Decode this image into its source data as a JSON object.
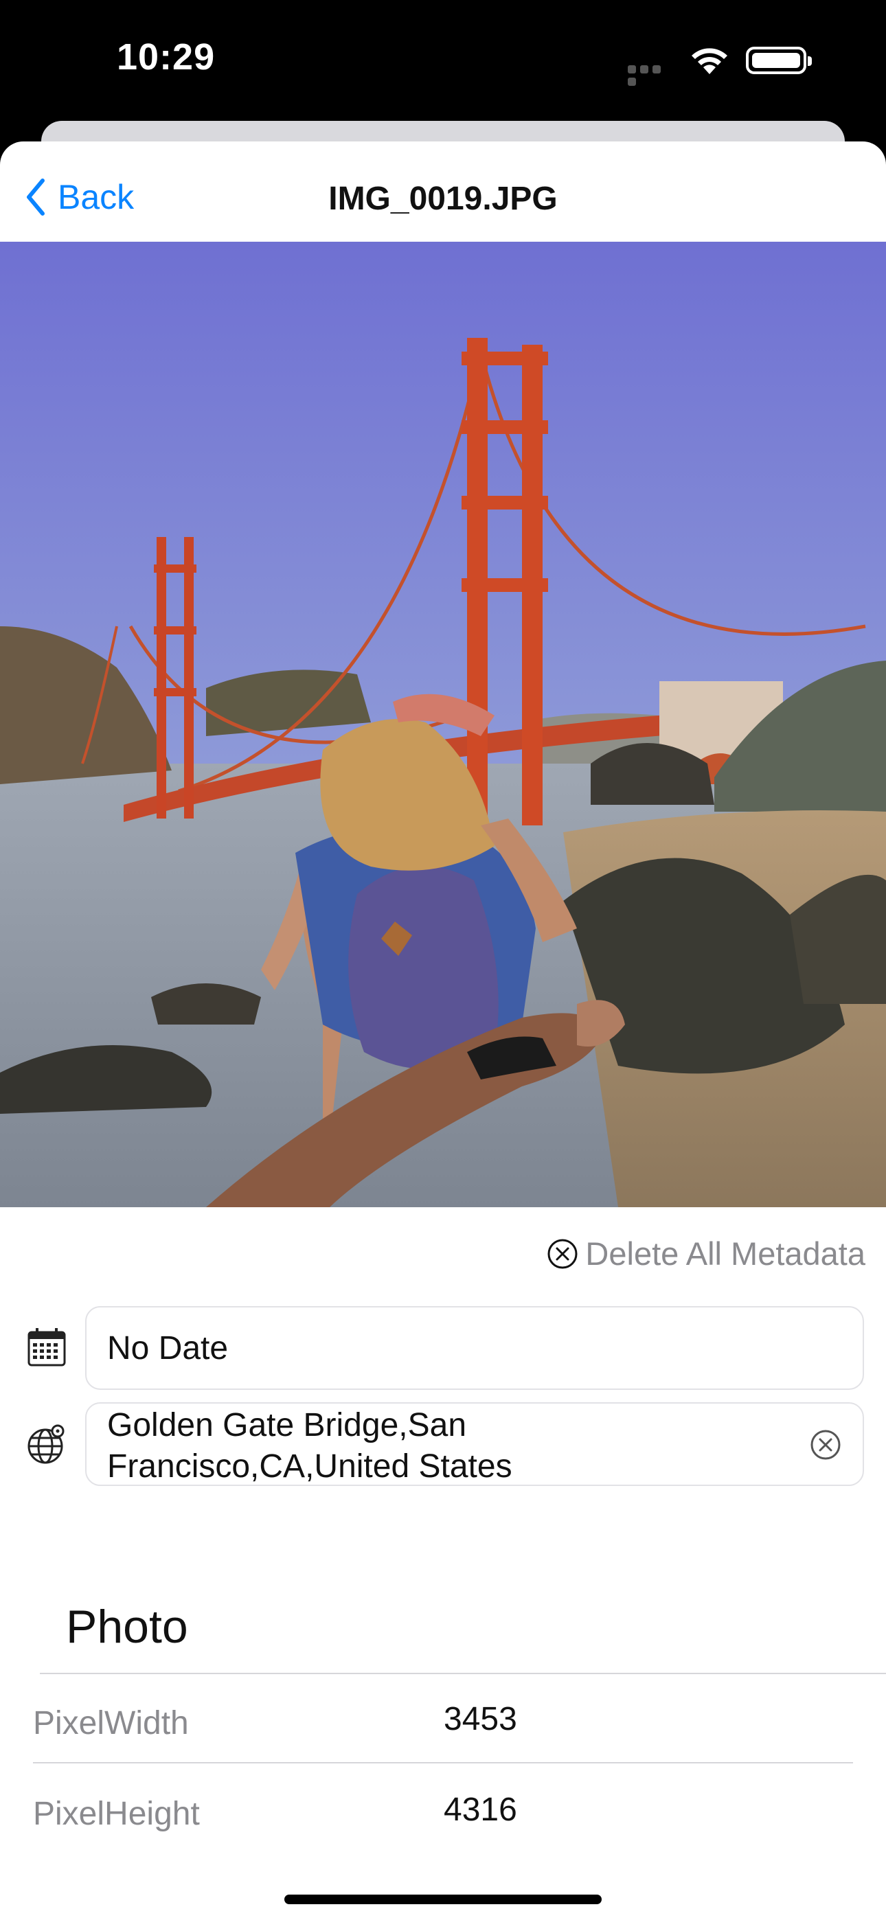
{
  "status": {
    "time": "10:29"
  },
  "nav": {
    "back_label": "Back",
    "title": "IMG_0019.JPG"
  },
  "photo": {
    "description": ""
  },
  "actions": {
    "delete_all_label": "Delete All Metadata"
  },
  "date_field": {
    "icon": "calendar-icon",
    "value": "No Date"
  },
  "location_field": {
    "icon": "globe-location-icon",
    "line1": "Golden Gate Bridge,San",
    "line2": "Francisco,CA,United States"
  },
  "section": {
    "title": "Photo",
    "rows": [
      {
        "key": "PixelWidth",
        "value": "3453"
      },
      {
        "key": "PixelHeight",
        "value": "4316"
      }
    ]
  },
  "colors": {
    "accent": "#0a84ff",
    "secondary_text": "#8a8a8e"
  }
}
